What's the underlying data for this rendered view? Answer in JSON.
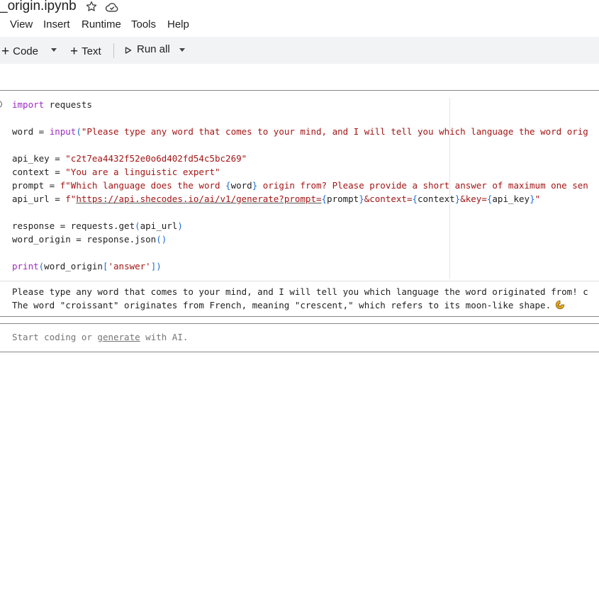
{
  "notebook": {
    "title": "_origin.ipynb",
    "icons": [
      "star-icon",
      "cloud-icon"
    ]
  },
  "menu": [
    {
      "label": "View"
    },
    {
      "label": "Insert"
    },
    {
      "label": "Runtime"
    },
    {
      "label": "Tools"
    },
    {
      "label": "Help"
    }
  ],
  "toolbar": {
    "code_label": "Code",
    "text_label": "Text",
    "run_all_label": "Run all"
  },
  "code_cell": {
    "lines": [
      "import requests",
      "",
      "word = input(\"Please type any word that comes to your mind, and I will tell you which language the word orig",
      "",
      "api_key = \"c2t7ea4432f52e0o6d402fd54c5bc269\"",
      "context = \"You are a linguistic expert\"",
      "prompt = f\"Which language does the word {word} origin from? Please provide a short answer of maximum one sen",
      "api_url = f\"https://api.shecodes.io/ai/v1/generate?prompt={prompt}&context={context}&key={api_key}\"",
      "",
      "response = requests.get(api_url)",
      "word_origin = response.json()",
      "",
      "print(word_origin['answer'])"
    ],
    "output": [
      "Please type any word that comes to your mind, and I will tell you which language the word originated from! c",
      "The word \"croissant\" originates from French, meaning \"crescent,\" which refers to its moon-like shape."
    ],
    "output_emoji": "croissant-emoji"
  },
  "empty_cell": {
    "placeholder_before": "Start coding or ",
    "placeholder_link": "generate",
    "placeholder_after": " with AI."
  }
}
